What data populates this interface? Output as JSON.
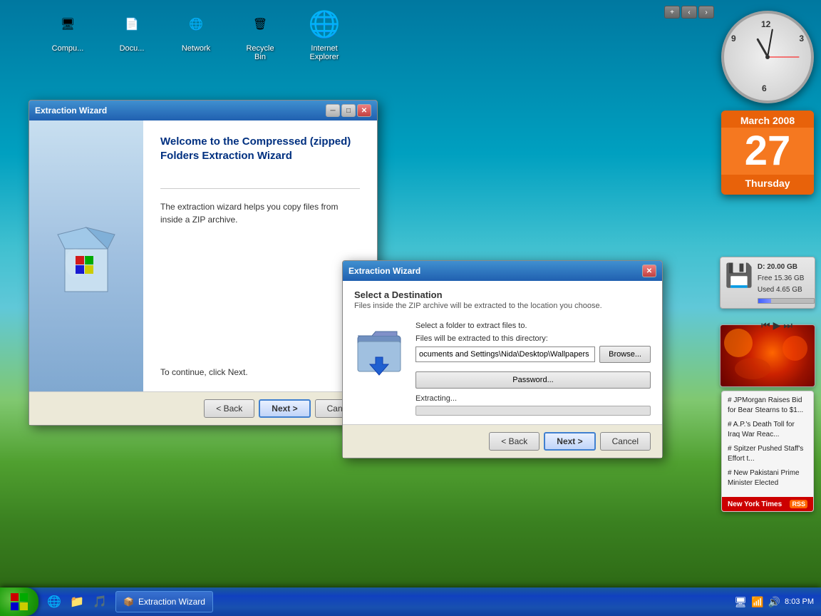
{
  "desktop": {
    "icons": [
      {
        "id": "computer",
        "label": "Compu...",
        "emoji": "🖥"
      },
      {
        "id": "documents",
        "label": "Docu...",
        "emoji": "📄"
      },
      {
        "id": "network",
        "label": "Network",
        "emoji": "🌐"
      },
      {
        "id": "recycle",
        "label": "Recycle\nBin",
        "emoji": "🗑"
      },
      {
        "id": "ie",
        "label": "Internet\nExplorer",
        "emoji": "🌐"
      }
    ]
  },
  "clock": {
    "label": "Clock"
  },
  "calendar": {
    "month": "March 2008",
    "day": "27",
    "weekday": "Thursday"
  },
  "storage": {
    "drive": "D:",
    "total": "20.00 GB",
    "free": "Free 15.36 GB",
    "used": "Used 4.65 GB"
  },
  "news": {
    "items": [
      "# JPMorgan Raises Bid for Bear Stearns to $1...",
      "# A.P.&#x2019;s Death Toll for Iraq War Reac...",
      "# Spitzer Pushed Staff&#x2019;s Effort t...",
      "# New Pakistani Prime Minister Elected"
    ],
    "source": "New York Times"
  },
  "window1": {
    "title": "Extraction Wizard",
    "heading": "Welcome to the Compressed (zipped) Folders Extraction Wizard",
    "description": "The extraction wizard helps you copy files from inside a ZIP archive.",
    "continue_text": "To continue, click Next.",
    "back_btn": "< Back",
    "next_btn": "Next >",
    "cancel_btn": "Cancel"
  },
  "window2": {
    "title": "Extraction Wizard",
    "section_title": "Select a Destination",
    "section_subtitle": "Files inside the ZIP archive will be extracted to the location you choose.",
    "folder_label": "Select a folder to extract files to.",
    "path_label": "Files will be extracted to this directory:",
    "path_value": "ocuments and Settings\\Nida\\Desktop\\Wallpapers",
    "browse_btn": "Browse...",
    "password_btn": "Password...",
    "extracting_label": "Extracting...",
    "back_btn": "< Back",
    "next_btn": "Next >",
    "cancel_btn": "Cancel"
  },
  "taskbar": {
    "start_label": "⊞",
    "app_label": "Extraction Wizard",
    "time": "8:03 PM"
  },
  "top_controls": {
    "plus": "+",
    "prev": "‹",
    "next": "›"
  }
}
